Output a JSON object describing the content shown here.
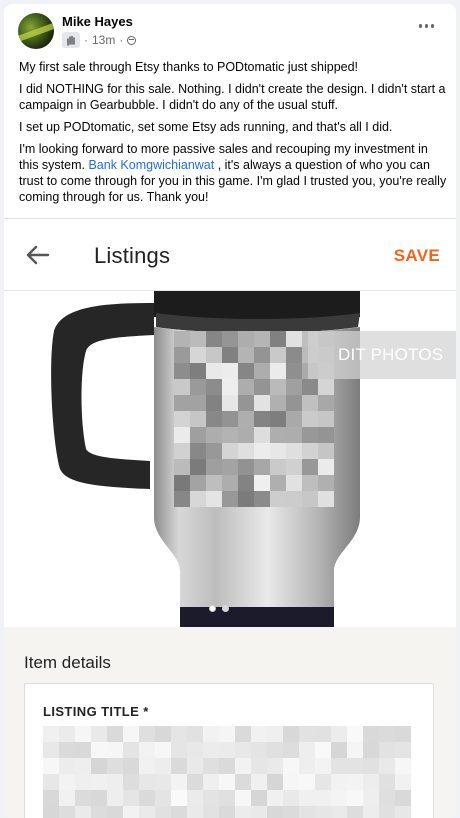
{
  "post": {
    "author": "Mike Hayes",
    "time": "13m",
    "separator": "·",
    "paragraphs": [
      "My first sale through Etsy thanks to PODtomatic just shipped!",
      "I did NOTHING for this sale. Nothing. I didn't create the design. I didn't start a campaign in Gearbubble. I didn't do any of the usual stuff.",
      "I set up PODtomatic, set some Etsy ads running, and that's all I did."
    ],
    "last_paragraph": {
      "before": "I'm looking forward to more passive sales and recouping my investment in this system. ",
      "mention": "Bank Komgwichianwat",
      "after": " , it's always a question of who you can trust to come through for you in this game. I'm glad I trusted you, you're really coming through for us. Thank you!"
    }
  },
  "etsy": {
    "title": "Listings",
    "save_label": "SAVE",
    "edit_photos_label": "DIT PHOTOS",
    "section_heading": "Item details",
    "field_label": "LISTING TITLE *",
    "carousel": {
      "count": 2,
      "active_index": 0
    }
  },
  "icons": [
    "avatar",
    "wave-badge-icon",
    "globe-icon",
    "more-icon",
    "back-arrow-icon"
  ],
  "colors": {
    "mention": "#216fdb",
    "save": "#f1641e",
    "muted": "#65676b"
  }
}
